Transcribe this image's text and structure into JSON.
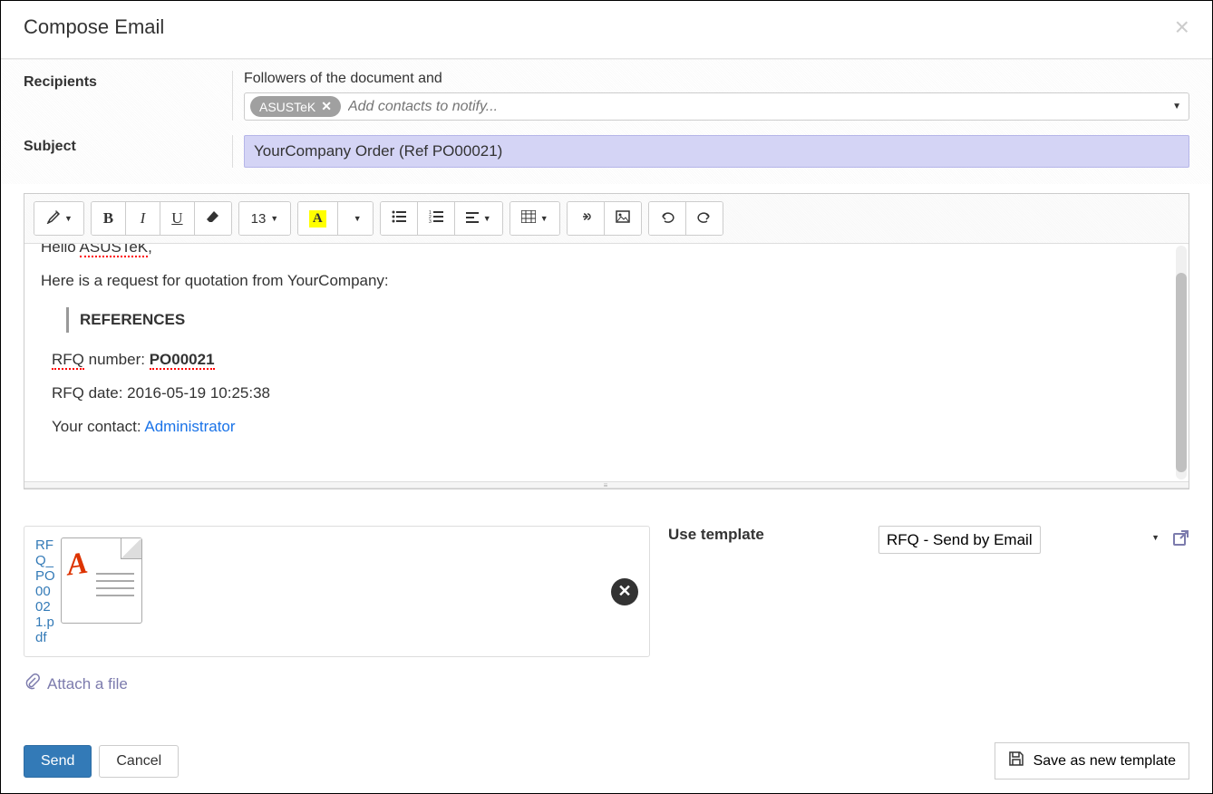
{
  "header": {
    "title": "Compose Email"
  },
  "form": {
    "recipients_label": "Recipients",
    "followers_text": "Followers of the document and",
    "tag": "ASUSTeK",
    "add_placeholder": "Add contacts to notify...",
    "subject_label": "Subject",
    "subject_value": "YourCompany Order (Ref PO00021)"
  },
  "toolbar": {
    "font_size": "13"
  },
  "body": {
    "greeting_hello": "Hello",
    "greeting_name": "ASUSTeK",
    "intro": "Here is a request for quotation from YourCompany:",
    "refs_heading": "REFERENCES",
    "rfq_label": "RFQ",
    "rfq_number_text": " number: ",
    "rfq_number": "PO00021",
    "rfq_date_label": "RFQ date: ",
    "rfq_date": "2016-05-19 10:25:38",
    "contact_label": "Your contact: ",
    "contact_name": "Administrator"
  },
  "attachment": {
    "filename": "RFQ_PO00021.pdf",
    "attach_link": "Attach a file"
  },
  "template": {
    "label": "Use template",
    "selected": "RFQ - Send by Email"
  },
  "footer": {
    "send": "Send",
    "cancel": "Cancel",
    "save_template": "Save as new template"
  }
}
